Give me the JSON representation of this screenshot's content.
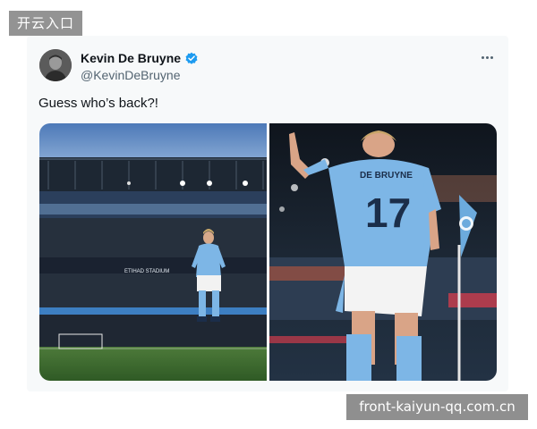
{
  "watermarks": {
    "top": "开云入口",
    "bottom": "front-kaiyun-qq.com.cn"
  },
  "tweet": {
    "display_name": "Kevin De Bruyne",
    "handle": "@KevinDeBruyne",
    "text": "Guess who’s back?!",
    "verified": true,
    "more_icon": "more-horizontal-icon"
  },
  "media": {
    "left_photo": {
      "banner_text": "ETIHAD STADIUM"
    },
    "right_photo": {
      "shirt_name": "DE BRUYNE",
      "shirt_number": "17"
    }
  },
  "colors": {
    "verified": "#1d9bf0",
    "city_blue": "#6cabdd"
  }
}
